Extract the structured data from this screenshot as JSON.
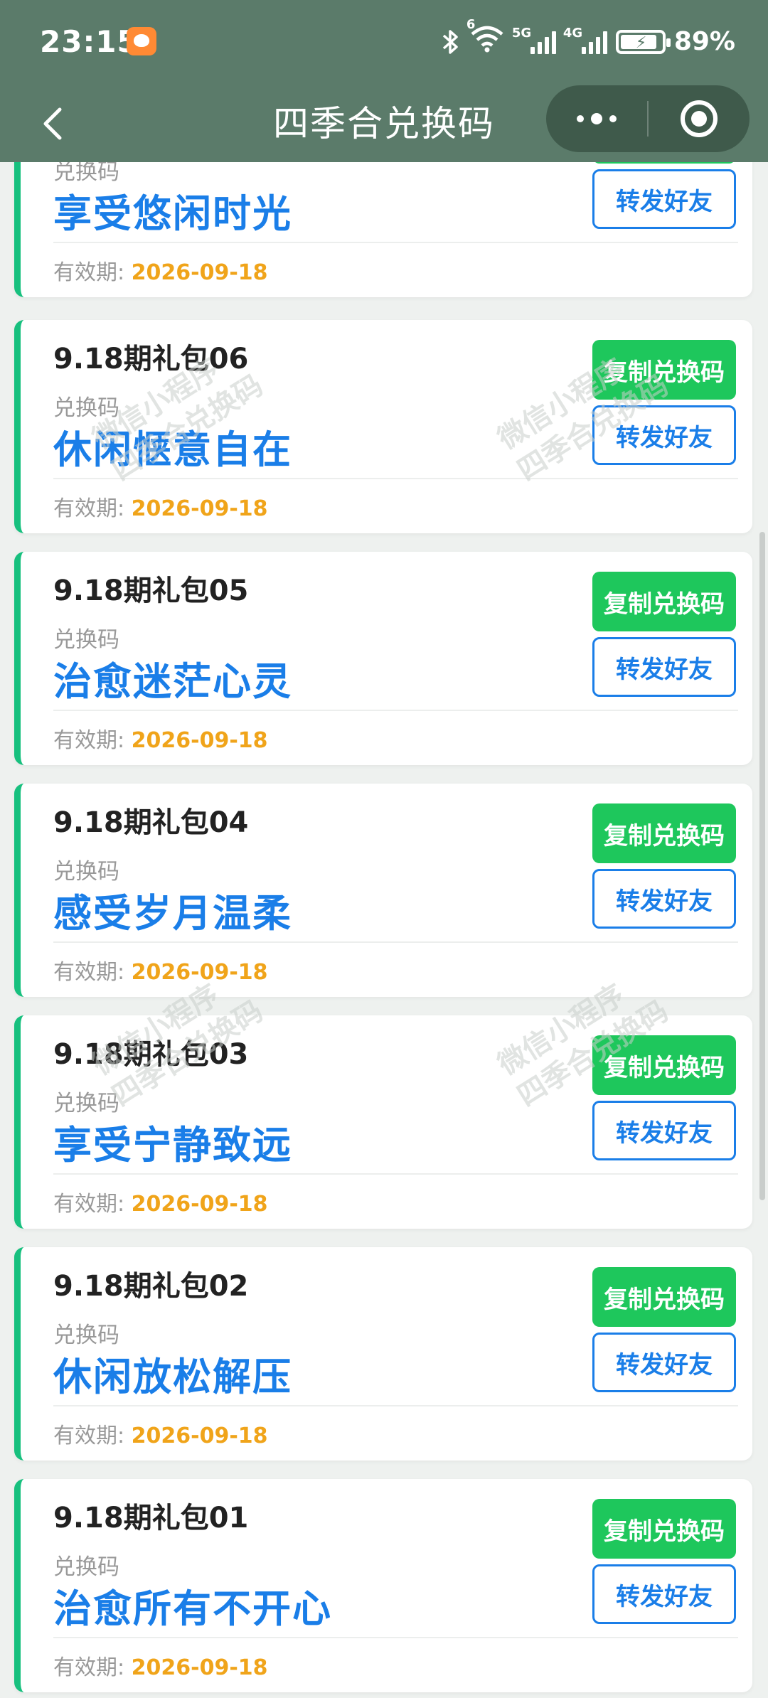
{
  "status": {
    "time": "23:15",
    "net1": "5G",
    "net2": "4G",
    "wifi_badge": "6",
    "battery": "89%",
    "battery_level": 0.89
  },
  "nav": {
    "title": "四季合兑换码"
  },
  "labels": {
    "code_label": "兑换码",
    "expiry_label": "有效期:",
    "copy_button": "复制兑换码",
    "share_button": "转发好友"
  },
  "watermark": {
    "line1": "微信小程序",
    "line2": "四季合兑换码"
  },
  "cards": [
    {
      "title": "",
      "code": "享受悠闲时光",
      "expiry": "2026-09-18"
    },
    {
      "title": "9.18期礼包06",
      "code": "休闲惬意自在",
      "expiry": "2026-09-18"
    },
    {
      "title": "9.18期礼包05",
      "code": "治愈迷茫心灵",
      "expiry": "2026-09-18"
    },
    {
      "title": "9.18期礼包04",
      "code": "感受岁月温柔",
      "expiry": "2026-09-18"
    },
    {
      "title": "9.18期礼包03",
      "code": "享受宁静致远",
      "expiry": "2026-09-18"
    },
    {
      "title": "9.18期礼包02",
      "code": "休闲放松解压",
      "expiry": "2026-09-18"
    },
    {
      "title": "9.18期礼包01",
      "code": "治愈所有不开心",
      "expiry": "2026-09-18"
    }
  ],
  "colors": {
    "header_bg": "#5b7b6a",
    "accent_green": "#1ec75c",
    "card_border": "#17c07e",
    "code_blue": "#1a7ee8",
    "expiry_orange": "#f0a41a"
  }
}
